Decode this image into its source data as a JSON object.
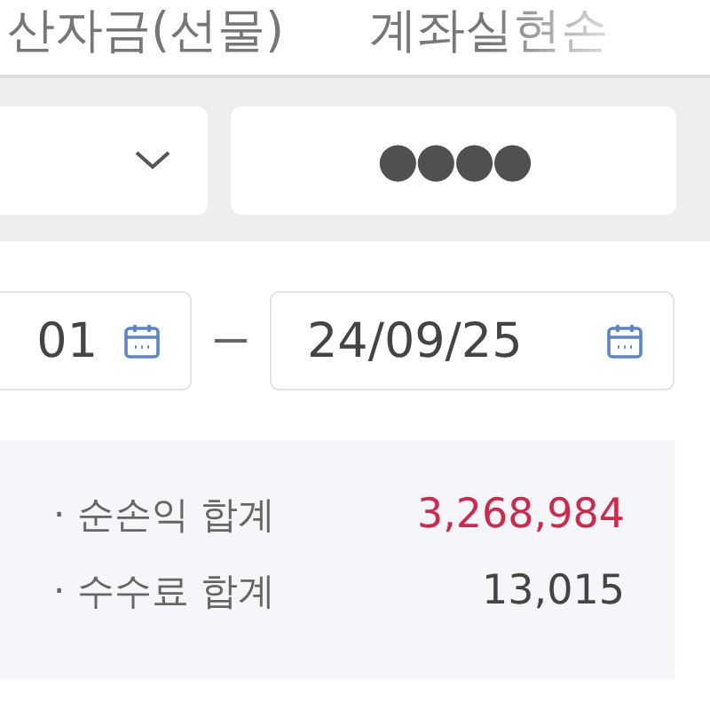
{
  "tabs": [
    {
      "label": "산자금(선물)",
      "selected": false
    },
    {
      "label": "계좌실현손",
      "selected": false
    }
  ],
  "account": {
    "password": "●●●●"
  },
  "period": {
    "start": "01",
    "end": "24/09/25"
  },
  "summary": [
    {
      "label": "· 순손익 합계",
      "value": "3,268,984",
      "kind": "profit"
    },
    {
      "label": "· 수수료 합계",
      "value": "13,015",
      "kind": "plain"
    }
  ]
}
